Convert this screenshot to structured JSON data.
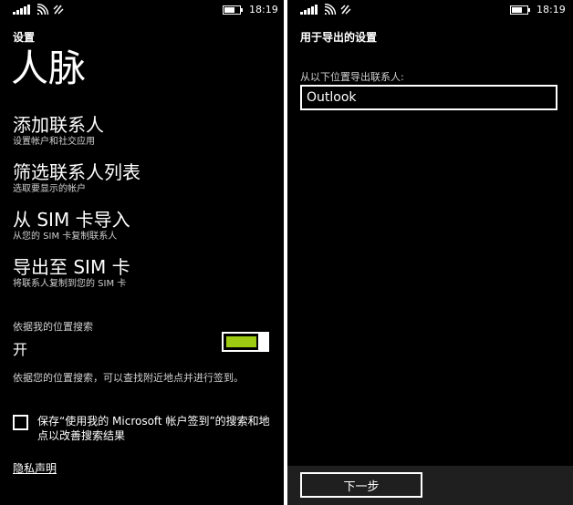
{
  "left": {
    "status": {
      "time": "18:19"
    },
    "header": {
      "app_name": "设置",
      "title": "人脉"
    },
    "menu": [
      {
        "title": "添加联系人",
        "subtitle": "设置帐户和社交应用"
      },
      {
        "title": "筛选联系人列表",
        "subtitle": "选取要显示的帐户"
      },
      {
        "title": "从 SIM 卡导入",
        "subtitle": "从您的 SIM 卡复制联系人"
      },
      {
        "title": "导出至 SIM 卡",
        "subtitle": "将联系人复制到您的 SIM 卡"
      }
    ],
    "location": {
      "label": "依据我的位置搜索",
      "state": "开",
      "on": true,
      "description": "依据您的位置搜索，可以查找附近地点并进行签到。"
    },
    "save_option": {
      "label": "保存“使用我的 Microsoft 帐户签到”的搜索和地点以改善搜索结果",
      "checked": false
    },
    "privacy_link": "隐私声明",
    "colors": {
      "accent": "#9ecb12"
    }
  },
  "right": {
    "status": {
      "time": "18:19"
    },
    "header": {
      "title": "用于导出的设置"
    },
    "export": {
      "label": "从以下位置导出联系人:",
      "selected": "Outlook"
    },
    "appbar": {
      "next_label": "下一步"
    }
  }
}
